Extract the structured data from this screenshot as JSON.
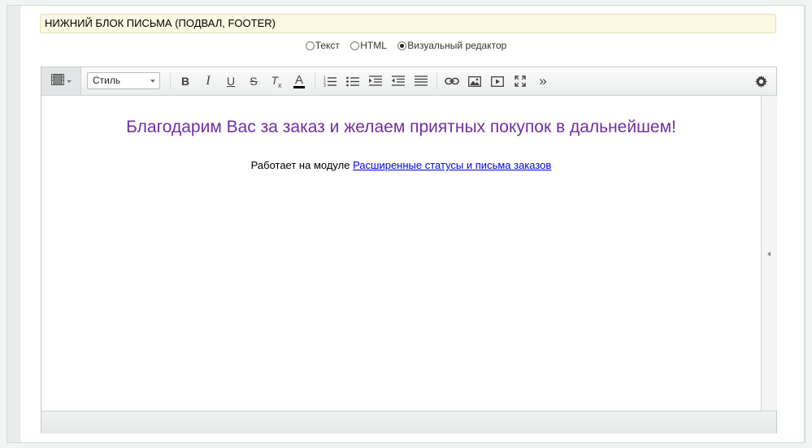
{
  "section": {
    "title": "НИЖНИЙ БЛОК ПИСЬМА (ПОДВАЛ, FOOTER)"
  },
  "modes": [
    {
      "label": "Текст",
      "checked": false
    },
    {
      "label": "HTML",
      "checked": false
    },
    {
      "label": "Визуальный редактор",
      "checked": true
    }
  ],
  "toolbar": {
    "style_select": "Стиль",
    "buttons": {
      "bold": "B",
      "italic": "I",
      "underline": "U",
      "strike": "S",
      "remove_format": "T",
      "remove_format_sub": "x",
      "font_color": "A",
      "more": "»"
    },
    "icons": [
      "view-mode-icon",
      "bold-icon",
      "italic-icon",
      "underline-icon",
      "strikethrough-icon",
      "remove-format-icon",
      "font-color-icon",
      "ordered-list-icon",
      "unordered-list-icon",
      "indent-icon",
      "outdent-icon",
      "align-justify-icon",
      "link-icon",
      "image-icon",
      "video-icon",
      "fullscreen-icon",
      "more-icon",
      "settings-gear-icon"
    ]
  },
  "content": {
    "thanks": "Благодарим Вас за заказ и желаем приятных покупок в дальнейшем!",
    "powered_prefix": "Работает на модуле ",
    "powered_link": "Расширенные статусы и письма заказов"
  },
  "colors": {
    "thanks_text": "#7030a0",
    "link": "#0000ee",
    "title_bg": "#fbf9e2"
  }
}
